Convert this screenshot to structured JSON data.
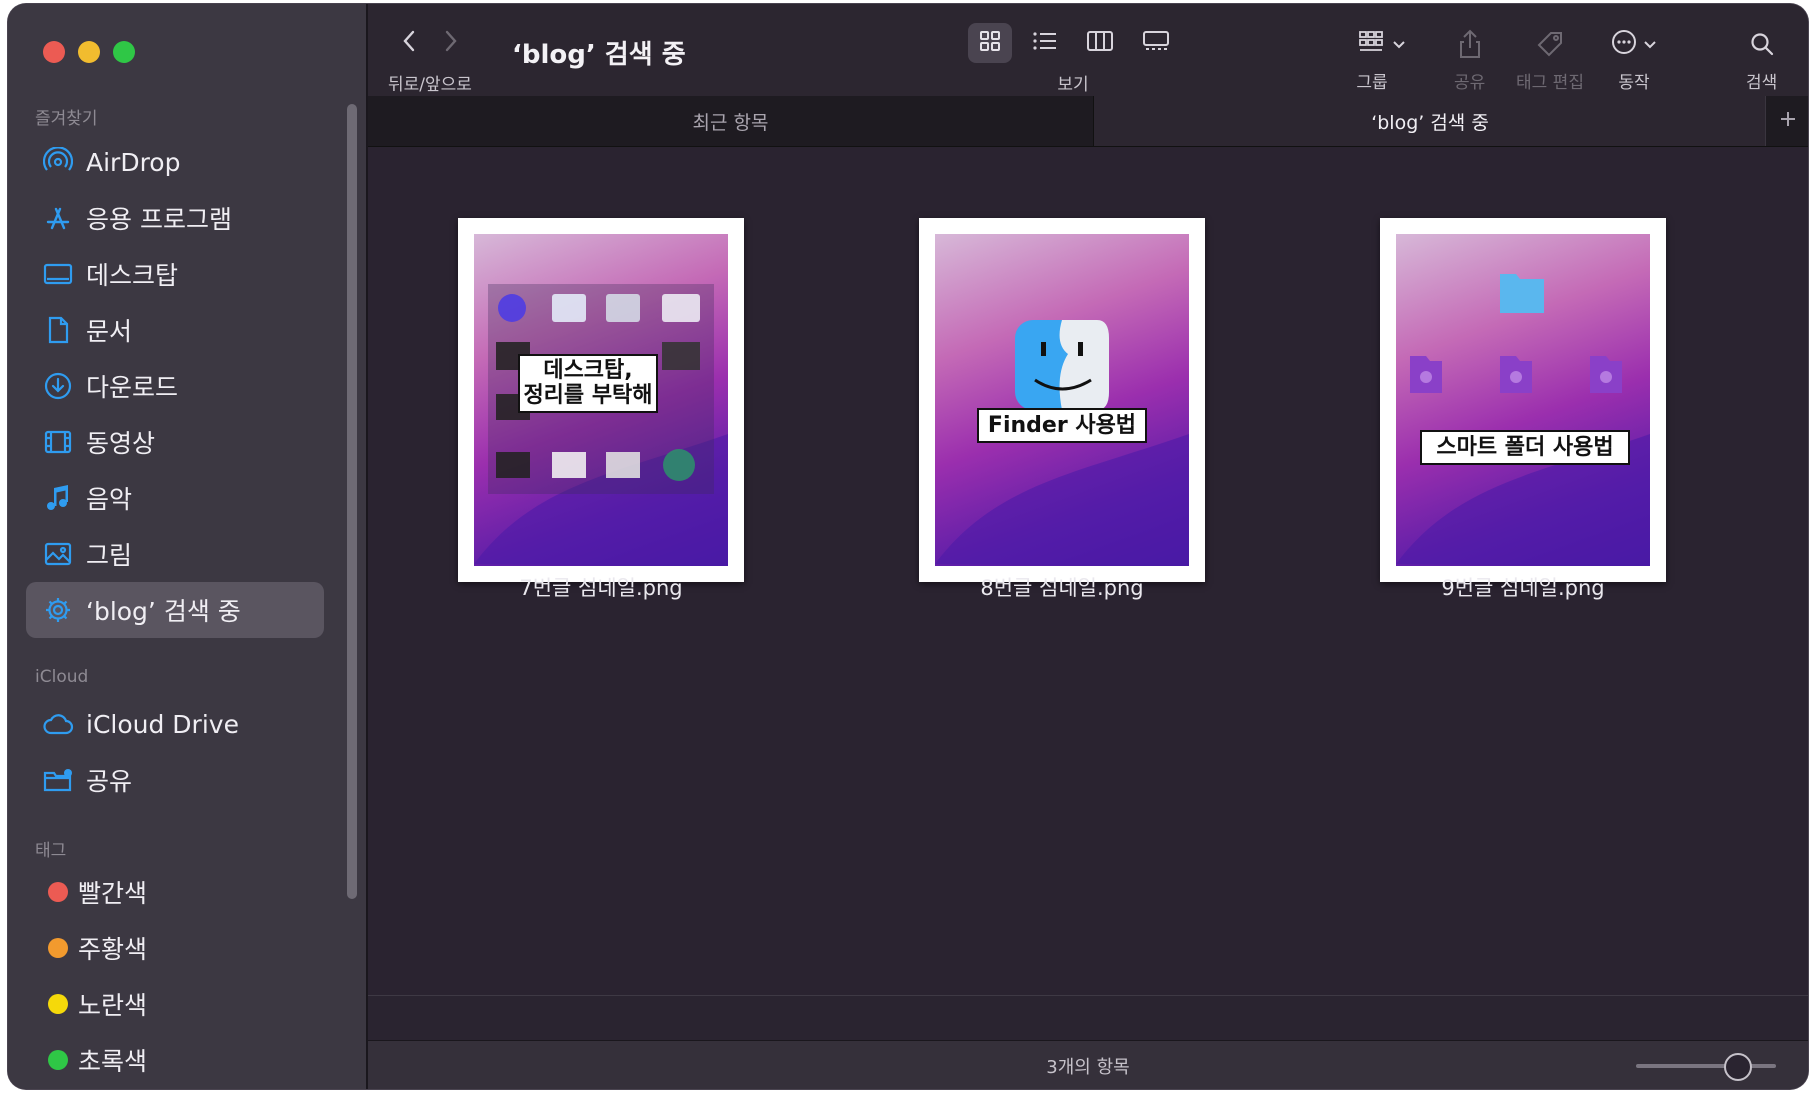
{
  "window": {
    "title": "‘blog’ 검색 중"
  },
  "toolbar": {
    "nav_label": "뒤로/앞으로",
    "view_label": "보기",
    "group_label": "그룹",
    "share_label": "공유",
    "tag_label": "태그 편집",
    "action_label": "동작",
    "search_label": "검색"
  },
  "tabs": [
    {
      "label": "최근 항목",
      "active": false
    },
    {
      "label": "‘blog’ 검색 중",
      "active": true
    }
  ],
  "sidebar": {
    "favorites_label": "즐겨찾기",
    "favorites": [
      {
        "label": "AirDrop",
        "icon": "airdrop-icon"
      },
      {
        "label": "응용 프로그램",
        "icon": "applications-icon"
      },
      {
        "label": "데스크탑",
        "icon": "desktop-icon"
      },
      {
        "label": "문서",
        "icon": "document-icon"
      },
      {
        "label": "다운로드",
        "icon": "download-icon"
      },
      {
        "label": "동영상",
        "icon": "movies-icon"
      },
      {
        "label": "음악",
        "icon": "music-icon"
      },
      {
        "label": "그림",
        "icon": "pictures-icon"
      },
      {
        "label": "‘blog’ 검색 중",
        "icon": "smart-folder-gear-icon",
        "selected": true
      }
    ],
    "icloud_label": "iCloud",
    "icloud": [
      {
        "label": "iCloud Drive",
        "icon": "icloud-icon"
      },
      {
        "label": "공유",
        "icon": "shared-folder-icon"
      }
    ],
    "tags_label": "태그",
    "tags": [
      {
        "label": "빨간색",
        "color": "#ec5b53"
      },
      {
        "label": "주황색",
        "color": "#f29a2e"
      },
      {
        "label": "노란색",
        "color": "#f5d90a"
      },
      {
        "label": "초록색",
        "color": "#2fc746"
      }
    ]
  },
  "files": [
    {
      "name": "7번글 섬네일.png",
      "caption_line1": "데스크탑,",
      "caption_line2": "정리를 부탁해"
    },
    {
      "name": "8번글 섬네일.png",
      "caption_line1": "Finder 사용법"
    },
    {
      "name": "9번글 섬네일.png",
      "caption_line1": "스마트 폴더 사용법"
    }
  ],
  "status": {
    "item_count": "3개의 항목"
  },
  "colors": {
    "accent": "#2f9cf0",
    "selected_bg": "#5a5560"
  }
}
